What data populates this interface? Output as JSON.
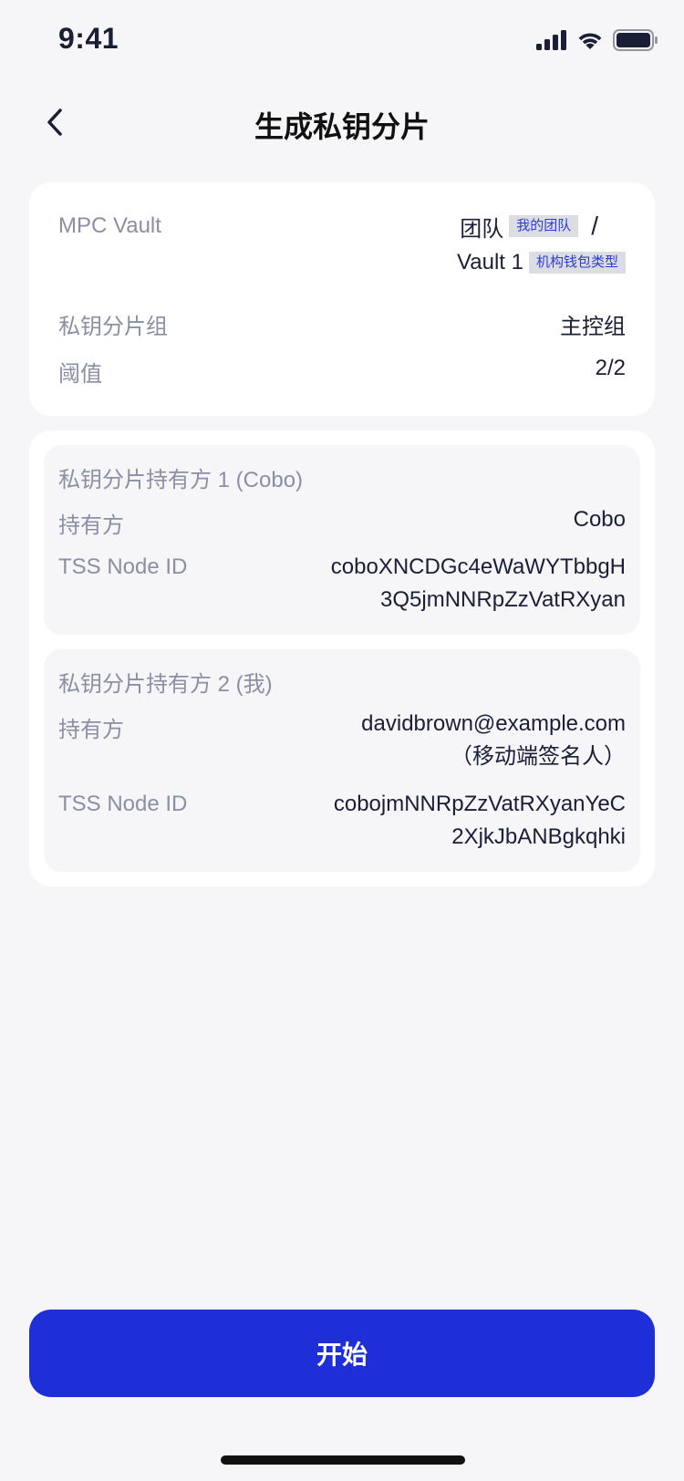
{
  "status_bar": {
    "time": "9:41"
  },
  "header": {
    "title": "生成私钥分片"
  },
  "vault_card": {
    "mpc_label": "MPC Vault",
    "team_name": "团队",
    "team_tag": "我的团队",
    "separator": "/",
    "vault_name": "Vault 1",
    "vault_tag": "机构钱包类型",
    "shard_group_label": "私钥分片组",
    "shard_group_value": "主控组",
    "threshold_label": "阈值",
    "threshold_value": "2/2"
  },
  "holders": [
    {
      "title": "私钥分片持有方 1 (Cobo)",
      "holder_label": "持有方",
      "holder_value": "Cobo",
      "node_label": "TSS Node ID",
      "node_line1": "coboXNCDGc4eWaWYTbbgH",
      "node_line2": "3Q5jmNNRpZzVatRXyan"
    },
    {
      "title": "私钥分片持有方 2 (我)",
      "holder_label": "持有方",
      "holder_value": "davidbrown@example.com",
      "holder_note": "（移动端签名人）",
      "node_label": "TSS Node ID",
      "node_line1": "cobojmNNRpZzVatRXyanYeC",
      "node_line2": "2XjkJbANBgkqhki"
    }
  ],
  "actions": {
    "start_label": "开始"
  },
  "icons": {
    "back": "chevron-left-icon",
    "signal": "cellular-signal-icon",
    "wifi": "wifi-icon",
    "battery": "battery-icon"
  },
  "colors": {
    "primary": "#1f2fd8",
    "tag_text": "#2e3ad6",
    "tag_bg": "#dcdde3",
    "background": "#f6f6f8"
  }
}
